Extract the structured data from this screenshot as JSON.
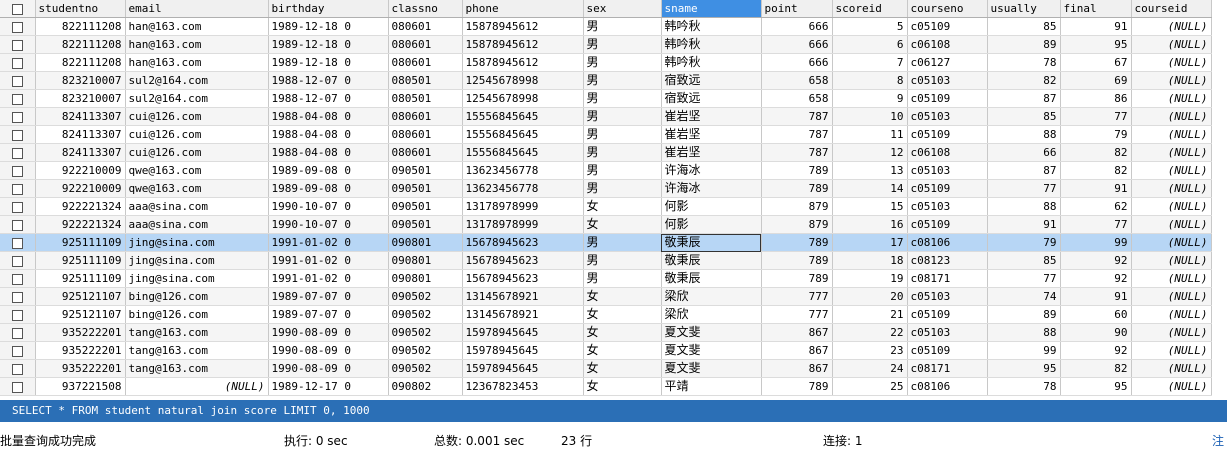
{
  "grid": {
    "columns": [
      "studentno",
      "email",
      "birthday",
      "classno",
      "phone",
      "sex",
      "sname",
      "point",
      "scoreid",
      "courseno",
      "usually",
      "final",
      "courseid"
    ],
    "sorted_column": "sname",
    "selected_row": 12,
    "rows": [
      [
        "822111208",
        "han@163.com",
        "1989-12-18 0",
        "080601",
        "15878945612",
        "男",
        "韩吟秋",
        "666",
        "5",
        "c05109",
        "85",
        "91",
        "(NULL)"
      ],
      [
        "822111208",
        "han@163.com",
        "1989-12-18 0",
        "080601",
        "15878945612",
        "男",
        "韩吟秋",
        "666",
        "6",
        "c06108",
        "89",
        "95",
        "(NULL)"
      ],
      [
        "822111208",
        "han@163.com",
        "1989-12-18 0",
        "080601",
        "15878945612",
        "男",
        "韩吟秋",
        "666",
        "7",
        "c06127",
        "78",
        "67",
        "(NULL)"
      ],
      [
        "823210007",
        "sul2@164.com",
        "1988-12-07 0",
        "080501",
        "12545678998",
        "男",
        "宿致远",
        "658",
        "8",
        "c05103",
        "82",
        "69",
        "(NULL)"
      ],
      [
        "823210007",
        "sul2@164.com",
        "1988-12-07 0",
        "080501",
        "12545678998",
        "男",
        "宿致远",
        "658",
        "9",
        "c05109",
        "87",
        "86",
        "(NULL)"
      ],
      [
        "824113307",
        "cui@126.com",
        "1988-04-08 0",
        "080601",
        "15556845645",
        "男",
        "崔岩坚",
        "787",
        "10",
        "c05103",
        "85",
        "77",
        "(NULL)"
      ],
      [
        "824113307",
        "cui@126.com",
        "1988-04-08 0",
        "080601",
        "15556845645",
        "男",
        "崔岩坚",
        "787",
        "11",
        "c05109",
        "88",
        "79",
        "(NULL)"
      ],
      [
        "824113307",
        "cui@126.com",
        "1988-04-08 0",
        "080601",
        "15556845645",
        "男",
        "崔岩坚",
        "787",
        "12",
        "c06108",
        "66",
        "82",
        "(NULL)"
      ],
      [
        "922210009",
        "qwe@163.com",
        "1989-09-08 0",
        "090501",
        "13623456778",
        "男",
        "许海冰",
        "789",
        "13",
        "c05103",
        "87",
        "82",
        "(NULL)"
      ],
      [
        "922210009",
        "qwe@163.com",
        "1989-09-08 0",
        "090501",
        "13623456778",
        "男",
        "许海冰",
        "789",
        "14",
        "c05109",
        "77",
        "91",
        "(NULL)"
      ],
      [
        "922221324",
        "aaa@sina.com",
        "1990-10-07 0",
        "090501",
        "13178978999",
        "女",
        "何影",
        "879",
        "15",
        "c05103",
        "88",
        "62",
        "(NULL)"
      ],
      [
        "922221324",
        "aaa@sina.com",
        "1990-10-07 0",
        "090501",
        "13178978999",
        "女",
        "何影",
        "879",
        "16",
        "c05109",
        "91",
        "77",
        "(NULL)"
      ],
      [
        "925111109",
        "jing@sina.com",
        "1991-01-02 0",
        "090801",
        "15678945623",
        "男",
        "敬秉辰",
        "789",
        "17",
        "c08106",
        "79",
        "99",
        "(NULL)"
      ],
      [
        "925111109",
        "jing@sina.com",
        "1991-01-02 0",
        "090801",
        "15678945623",
        "男",
        "敬秉辰",
        "789",
        "18",
        "c08123",
        "85",
        "92",
        "(NULL)"
      ],
      [
        "925111109",
        "jing@sina.com",
        "1991-01-02 0",
        "090801",
        "15678945623",
        "男",
        "敬秉辰",
        "789",
        "19",
        "c08171",
        "77",
        "92",
        "(NULL)"
      ],
      [
        "925121107",
        "bing@126.com",
        "1989-07-07 0",
        "090502",
        "13145678921",
        "女",
        "梁欣",
        "777",
        "20",
        "c05103",
        "74",
        "91",
        "(NULL)"
      ],
      [
        "925121107",
        "bing@126.com",
        "1989-07-07 0",
        "090502",
        "13145678921",
        "女",
        "梁欣",
        "777",
        "21",
        "c05109",
        "89",
        "60",
        "(NULL)"
      ],
      [
        "935222201",
        "tang@163.com",
        "1990-08-09 0",
        "090502",
        "15978945645",
        "女",
        "夏文斐",
        "867",
        "22",
        "c05103",
        "88",
        "90",
        "(NULL)"
      ],
      [
        "935222201",
        "tang@163.com",
        "1990-08-09 0",
        "090502",
        "15978945645",
        "女",
        "夏文斐",
        "867",
        "23",
        "c05109",
        "99",
        "92",
        "(NULL)"
      ],
      [
        "935222201",
        "tang@163.com",
        "1990-08-09 0",
        "090502",
        "15978945645",
        "女",
        "夏文斐",
        "867",
        "24",
        "c08171",
        "95",
        "82",
        "(NULL)"
      ],
      [
        "937221508",
        "(NULL)",
        "1989-12-17 0",
        "090802",
        "12367823453",
        "女",
        "平靖",
        "789",
        "25",
        "c08106",
        "78",
        "95",
        "(NULL)"
      ]
    ]
  },
  "query_bar": {
    "sql": "SELECT * FROM student natural join score LIMIT 0, 1000"
  },
  "status": {
    "message": "批量查询成功完成",
    "exec": "执行: 0 sec",
    "total": "总数: 0.001 sec",
    "rows": "23 行",
    "connection": "连接: 1",
    "note": "注"
  }
}
